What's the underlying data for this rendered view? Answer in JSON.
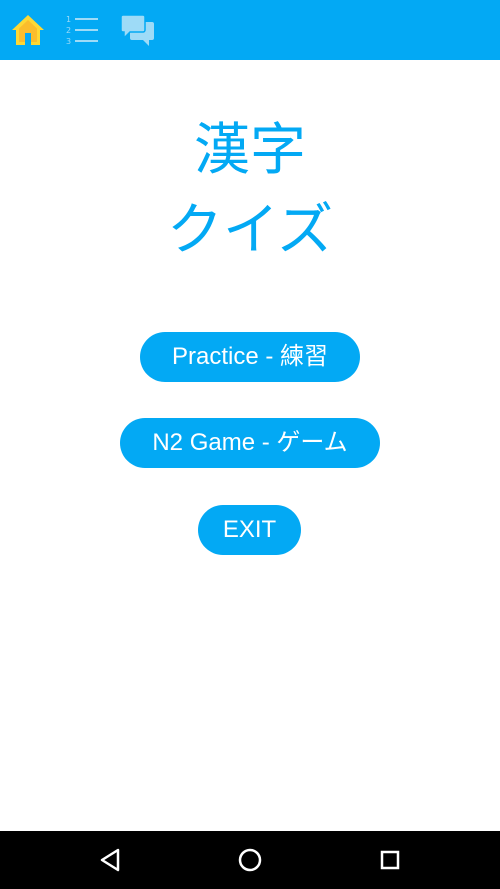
{
  "toolbar": {
    "icons": [
      "home-icon",
      "numbered-list-icon",
      "chat-icon"
    ],
    "colors": {
      "bar": "#03A9F4",
      "home_icon": "#FDD835",
      "inactive_icon": "#9EDBF7"
    }
  },
  "main": {
    "title_line1": "漢字",
    "title_line2": "クイズ",
    "practice_label": "Practice - 練習",
    "game_label": "N2 Game - ゲーム",
    "exit_label": "EXIT",
    "accent_color": "#03A9F4"
  },
  "navbar": {
    "icons": [
      "back-triangle-icon",
      "home-circle-icon",
      "recents-square-icon"
    ]
  }
}
